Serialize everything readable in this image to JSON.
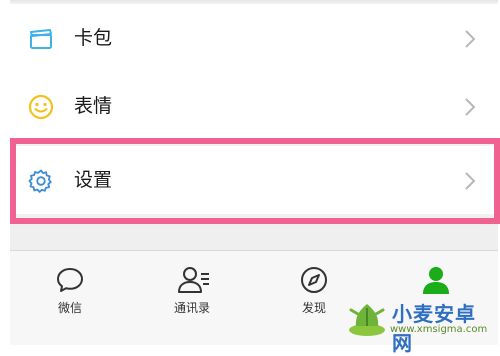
{
  "menu": {
    "items": [
      {
        "label": "卡包",
        "icon": "card-icon"
      },
      {
        "label": "表情",
        "icon": "smiley-icon"
      },
      {
        "label": "设置",
        "icon": "gear-icon"
      }
    ]
  },
  "tabbar": {
    "tabs": [
      {
        "label": "微信",
        "icon": "chat-bubble-icon"
      },
      {
        "label": "通讯录",
        "icon": "contacts-icon"
      },
      {
        "label": "发现",
        "icon": "compass-icon"
      },
      {
        "label": "",
        "icon": "profile-icon",
        "active": true
      }
    ]
  },
  "watermark": {
    "title": "小麦安卓网",
    "url": "www.xmsigma.com"
  },
  "colors": {
    "highlight": "#f0628f",
    "active_tab": "#1aad19",
    "gear": "#3b8cd9",
    "card": "#3fb0e8",
    "smiley": "#f1c21b"
  }
}
